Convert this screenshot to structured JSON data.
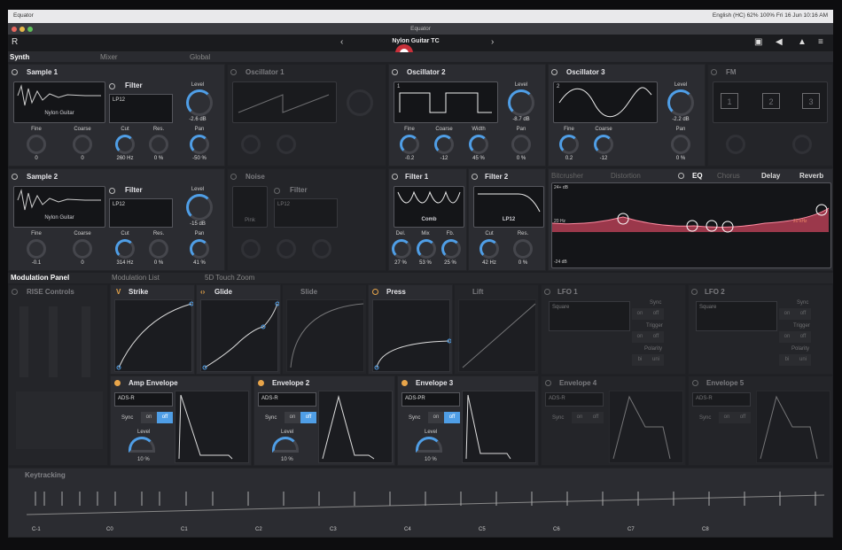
{
  "macbar": {
    "menu": "Equator",
    "status": "English (HC)   62%   100%   Fri 16 Jun  10:16 AM"
  },
  "window": {
    "title": "Equator"
  },
  "header": {
    "preset": "Nylon Guitar TC",
    "prev": "‹",
    "next": "›"
  },
  "tabs": {
    "synth": "Synth",
    "mixer": "Mixer",
    "global": "Global"
  },
  "sample1": {
    "title": "Sample 1",
    "sample_name": "Nylon Guitar",
    "fine_label": "Fine",
    "fine": "0",
    "coarse_label": "Coarse",
    "coarse": "0"
  },
  "filter1": {
    "title": "Filter",
    "type": "LP12",
    "level_label": "Level",
    "level": "-2.6 dB",
    "cut_label": "Cut",
    "cut": "260 Hz",
    "res_label": "Res.",
    "res": "0 %",
    "pan_label": "Pan",
    "pan": "-50 %"
  },
  "sample2": {
    "title": "Sample 2",
    "sample_name": "Nylon Guitar",
    "fine_label": "Fine",
    "fine": "-0.1",
    "coarse_label": "Coarse",
    "coarse": "0"
  },
  "filter2a": {
    "title": "Filter",
    "type": "LP12",
    "level_label": "Level",
    "level": "-15 dB",
    "cut_label": "Cut",
    "cut": "314 Hz",
    "res_label": "Res.",
    "res": "0 %",
    "pan_label": "Pan",
    "pan": "41 %"
  },
  "osc1": {
    "title": "Oscillator 1"
  },
  "noise": {
    "title": "Noise",
    "type": "Pink",
    "filter_title": "Filter",
    "filter_type": "LP12"
  },
  "osc2": {
    "title": "Oscillator 2",
    "num": "1",
    "level_label": "Level",
    "level": "-8.7 dB",
    "fine_label": "Fine",
    "fine": "-0.2",
    "coarse_label": "Coarse",
    "coarse": "-12",
    "width_label": "Width",
    "width": "45 %",
    "pan_label": "Pan",
    "pan": "0 %"
  },
  "osc3": {
    "title": "Oscillator 3",
    "num": "2",
    "level_label": "Level",
    "level": "-2.2 dB",
    "fine_label": "Fine",
    "fine": "0.2",
    "coarse_label": "Coarse",
    "coarse": "-12",
    "pan_label": "Pan",
    "pan": "0 %"
  },
  "fm": {
    "title": "FM",
    "n1": "1",
    "n2": "2",
    "n3": "3"
  },
  "filt1": {
    "title": "Filter 1",
    "type": "Comb",
    "del_label": "Del.",
    "del": "27 %",
    "mix_label": "Mix",
    "mix": "53 %",
    "fb_label": "Fb.",
    "fb": "25 %"
  },
  "filt2": {
    "title": "Filter 2",
    "type": "LP12",
    "cut_label": "Cut",
    "cut": "42 Hz",
    "res_label": "Res.",
    "res": "0 %"
  },
  "fx": {
    "bitcrusher": "Bitcrusher",
    "distortion": "Distortion",
    "eq": "EQ",
    "chorus": "Chorus",
    "delay": "Delay",
    "reverb": "Reverb",
    "top": "24+ dB",
    "mid": "20 Hz",
    "bot": "-24 dB",
    "right": "20 kHz"
  },
  "mod": {
    "panel": "Modulation Panel",
    "list": "Modulation List",
    "zoom": "5D Touch Zoom",
    "rise": "RISE Controls"
  },
  "dims": {
    "strike": "Strike",
    "glide": "Glide",
    "slide": "Slide",
    "press": "Press",
    "lift": "Lift"
  },
  "lfo1": {
    "title": "LFO 1",
    "shape": "Square",
    "sync": "Sync",
    "trigger": "Trigger",
    "polarity": "Polarity",
    "on": "on",
    "off": "off",
    "bi": "bi",
    "uni": "uni"
  },
  "lfo2": {
    "title": "LFO 2",
    "shape": "Square",
    "sync": "Sync",
    "trigger": "Trigger",
    "polarity": "Polarity",
    "on": "on",
    "off": "off",
    "bi": "bi",
    "uni": "uni"
  },
  "amp": {
    "title": "Amp Envelope",
    "type": "ADS-R",
    "sync": "Sync",
    "on": "on",
    "off": "off",
    "level_label": "Level",
    "level": "10 %"
  },
  "env2": {
    "title": "Envelope 2",
    "type": "ADS-R",
    "sync": "Sync",
    "on": "on",
    "off": "off",
    "level_label": "Level",
    "level": "10 %"
  },
  "env3": {
    "title": "Envelope 3",
    "type": "ADS-PR",
    "sync": "Sync",
    "on": "on",
    "off": "off",
    "level_label": "Level",
    "level": "10 %"
  },
  "env4": {
    "title": "Envelope 4",
    "type": "ADS-R",
    "sync": "Sync",
    "on": "on",
    "off": "off"
  },
  "env5": {
    "title": "Envelope 5",
    "type": "ADS-R",
    "sync": "Sync",
    "on": "on",
    "off": "off"
  },
  "keytracking": {
    "title": "Keytracking",
    "c_1": "C-1",
    "c0": "C0",
    "c1": "C1",
    "c2": "C2",
    "c3": "C3",
    "c4": "C4",
    "c5": "C5",
    "c6": "C6",
    "c7": "C7",
    "c8": "C8"
  },
  "colors": {
    "accent": "#4f9ee6",
    "eq": "#c8445c",
    "orange": "#e8a54a"
  }
}
